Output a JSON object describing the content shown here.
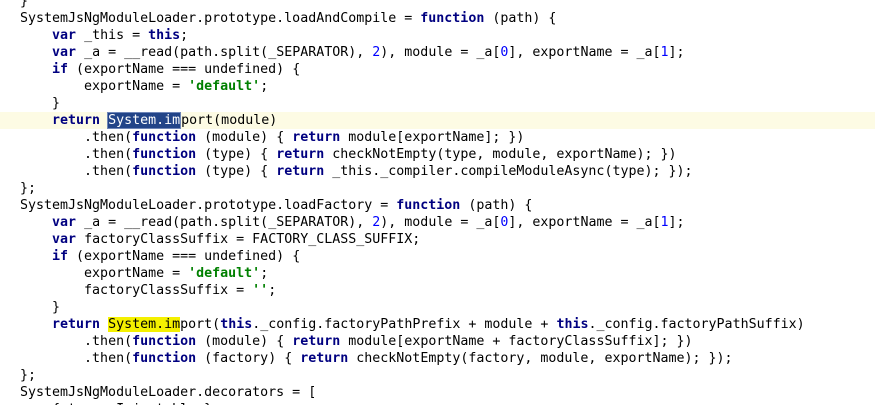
{
  "editor": {
    "lines": [
      {
        "indent": "",
        "tokens": [
          {
            "t": "}"
          }
        ]
      },
      {
        "indent": "",
        "tokens": [
          {
            "t": "SystemJsNgModuleLoader.prototype.loadAndCompile = "
          },
          {
            "t": "function",
            "c": "kw"
          },
          {
            "t": " (path) {"
          }
        ]
      },
      {
        "indent": "    ",
        "tokens": [
          {
            "t": "var",
            "c": "kw"
          },
          {
            "t": " _this = "
          },
          {
            "t": "this",
            "c": "kw"
          },
          {
            "t": ";"
          }
        ]
      },
      {
        "indent": "    ",
        "tokens": [
          {
            "t": "var",
            "c": "kw"
          },
          {
            "t": " _a = __read(path.split(_SEPARATOR), "
          },
          {
            "t": "2",
            "c": "num"
          },
          {
            "t": "), module = _a["
          },
          {
            "t": "0",
            "c": "num"
          },
          {
            "t": "], exportName = _a["
          },
          {
            "t": "1",
            "c": "num"
          },
          {
            "t": "];"
          }
        ]
      },
      {
        "indent": "    ",
        "tokens": [
          {
            "t": "if",
            "c": "kw"
          },
          {
            "t": " (exportName === undefined) {"
          }
        ]
      },
      {
        "indent": "        ",
        "tokens": [
          {
            "t": "exportName = "
          },
          {
            "t": "'default'",
            "c": "str"
          },
          {
            "t": ";"
          }
        ]
      },
      {
        "indent": "    ",
        "tokens": [
          {
            "t": "}"
          }
        ]
      },
      {
        "indent": "    ",
        "current": true,
        "tokens": [
          {
            "t": "return",
            "c": "kw"
          },
          {
            "t": " "
          },
          {
            "t": "System.im",
            "c": "hl-sel-box"
          },
          {
            "caret": true
          },
          {
            "t": "port(module)"
          }
        ]
      },
      {
        "indent": "        ",
        "tokens": [
          {
            "t": ".then("
          },
          {
            "t": "function",
            "c": "kw"
          },
          {
            "t": " (module) { "
          },
          {
            "t": "return",
            "c": "kw"
          },
          {
            "t": " module[exportName]; })"
          }
        ]
      },
      {
        "indent": "        ",
        "tokens": [
          {
            "t": ".then("
          },
          {
            "t": "function",
            "c": "kw"
          },
          {
            "t": " (type) { "
          },
          {
            "t": "return",
            "c": "kw"
          },
          {
            "t": " checkNotEmpty(type, module, exportName); })"
          }
        ]
      },
      {
        "indent": "        ",
        "tokens": [
          {
            "t": ".then("
          },
          {
            "t": "function",
            "c": "kw"
          },
          {
            "t": " (type) { "
          },
          {
            "t": "return",
            "c": "kw"
          },
          {
            "t": " _this._compiler.compileModuleAsync(type); });"
          }
        ]
      },
      {
        "indent": "",
        "tokens": [
          {
            "t": "};"
          }
        ]
      },
      {
        "indent": "",
        "tokens": [
          {
            "t": "SystemJsNgModuleLoader.prototype.loadFactory = "
          },
          {
            "t": "function",
            "c": "kw"
          },
          {
            "t": " (path) {"
          }
        ]
      },
      {
        "indent": "    ",
        "tokens": [
          {
            "t": "var",
            "c": "kw"
          },
          {
            "t": " _a = __read(path.split(_SEPARATOR), "
          },
          {
            "t": "2",
            "c": "num"
          },
          {
            "t": "), module = _a["
          },
          {
            "t": "0",
            "c": "num"
          },
          {
            "t": "], exportName = _a["
          },
          {
            "t": "1",
            "c": "num"
          },
          {
            "t": "];"
          }
        ]
      },
      {
        "indent": "    ",
        "tokens": [
          {
            "t": "var",
            "c": "kw"
          },
          {
            "t": " factoryClassSuffix = FACTORY_CLASS_SUFFIX;"
          }
        ]
      },
      {
        "indent": "    ",
        "tokens": [
          {
            "t": "if",
            "c": "kw"
          },
          {
            "t": " (exportName === undefined) {"
          }
        ]
      },
      {
        "indent": "        ",
        "tokens": [
          {
            "t": "exportName = "
          },
          {
            "t": "'default'",
            "c": "str"
          },
          {
            "t": ";"
          }
        ]
      },
      {
        "indent": "        ",
        "tokens": [
          {
            "t": "factoryClassSuffix = "
          },
          {
            "t": "''",
            "c": "str"
          },
          {
            "t": ";"
          }
        ]
      },
      {
        "indent": "    ",
        "tokens": [
          {
            "t": "}"
          }
        ]
      },
      {
        "indent": "    ",
        "tokens": [
          {
            "t": "return",
            "c": "kw"
          },
          {
            "t": " "
          },
          {
            "t": "System.im",
            "c": "hl-find"
          },
          {
            "t": "port("
          },
          {
            "t": "this",
            "c": "kw"
          },
          {
            "t": "._config.factoryPathPrefix + module + "
          },
          {
            "t": "this",
            "c": "kw"
          },
          {
            "t": "._config.factoryPathSuffix)"
          }
        ]
      },
      {
        "indent": "        ",
        "tokens": [
          {
            "t": ".then("
          },
          {
            "t": "function",
            "c": "kw"
          },
          {
            "t": " (module) { "
          },
          {
            "t": "return",
            "c": "kw"
          },
          {
            "t": " module[exportName + factoryClassSuffix]; })"
          }
        ]
      },
      {
        "indent": "        ",
        "tokens": [
          {
            "t": ".then("
          },
          {
            "t": "function",
            "c": "kw"
          },
          {
            "t": " (factory) { "
          },
          {
            "t": "return",
            "c": "kw"
          },
          {
            "t": " checkNotEmpty(factory, module, exportName); });"
          }
        ]
      },
      {
        "indent": "",
        "tokens": [
          {
            "t": "};"
          }
        ]
      },
      {
        "indent": "",
        "tokens": [
          {
            "t": "SystemJsNgModuleLoader.decorators = ["
          }
        ]
      },
      {
        "indent": "    ",
        "tokens": [
          {
            "t": "{ type: Injectable }"
          }
        ]
      }
    ],
    "colors": {
      "keyword": "#000080",
      "string": "#008000",
      "number": "#0000ff",
      "selection": "#224488",
      "search_match": "#f4f000",
      "current_line": "#fdfbe4"
    }
  }
}
